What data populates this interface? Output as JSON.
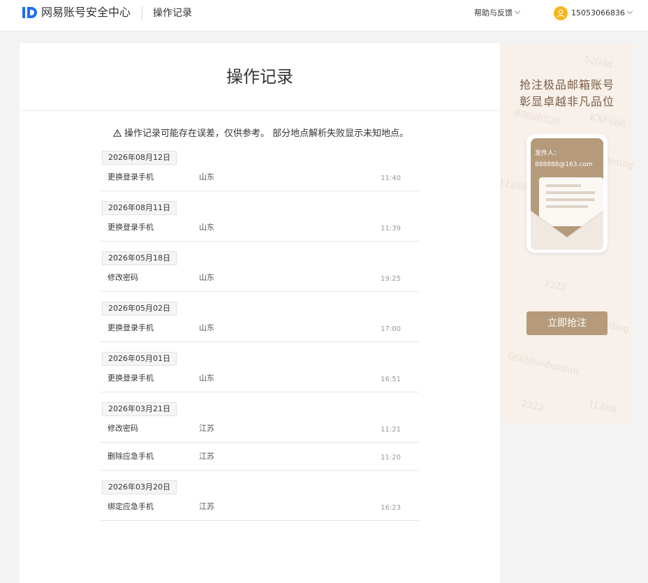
{
  "header": {
    "brand": "网易账号安全中心",
    "page_name": "操作记录",
    "help_label": "帮助与反馈",
    "account": "15053066836"
  },
  "main": {
    "title": "操作记录",
    "notice": "操作记录可能存在误差，仅供参考。 部分地点解析失败显示未知地点。",
    "groups": [
      {
        "date": "2026年08月12日",
        "records": [
          {
            "action": "更换登录手机",
            "place": "山东",
            "time": "11:40"
          }
        ]
      },
      {
        "date": "2026年08月11日",
        "records": [
          {
            "action": "更换登录手机",
            "place": "山东",
            "time": "11:39"
          }
        ]
      },
      {
        "date": "2026年05月18日",
        "records": [
          {
            "action": "修改密码",
            "place": "山东",
            "time": "19:25"
          }
        ]
      },
      {
        "date": "2026年05月02日",
        "records": [
          {
            "action": "更换登录手机",
            "place": "山东",
            "time": "17:00"
          }
        ]
      },
      {
        "date": "2026年05月01日",
        "records": [
          {
            "action": "更换登录手机",
            "place": "山东",
            "time": "16:51"
          }
        ]
      },
      {
        "date": "2026年03月21日",
        "records": [
          {
            "action": "修改密码",
            "place": "江苏",
            "time": "11:21"
          },
          {
            "action": "删除应急手机",
            "place": "江苏",
            "time": "11:20"
          }
        ]
      },
      {
        "date": "2026年03月20日",
        "records": [
          {
            "action": "绑定应急手机",
            "place": "江苏",
            "time": "16:23"
          }
        ]
      }
    ]
  },
  "ad": {
    "headline_line1": "抢注极品邮箱账号",
    "headline_line2": "彰显卓越非凡品位",
    "sender_label": "发件人：",
    "sender_email": "888888@163.com",
    "cta_label": "立即抢注",
    "watermarks": [
      "520dd",
      "88686520",
      "KXF666",
      "11288",
      "8ming",
      "3222",
      "ding",
      "666bluedundun",
      "1L888",
      "2222"
    ]
  },
  "colors": {
    "brand_blue": "#1f6ef0",
    "avatar_yellow": "#f6b51a",
    "ad_bg": "#f7f0eb",
    "ad_accent": "#b59b7c"
  }
}
